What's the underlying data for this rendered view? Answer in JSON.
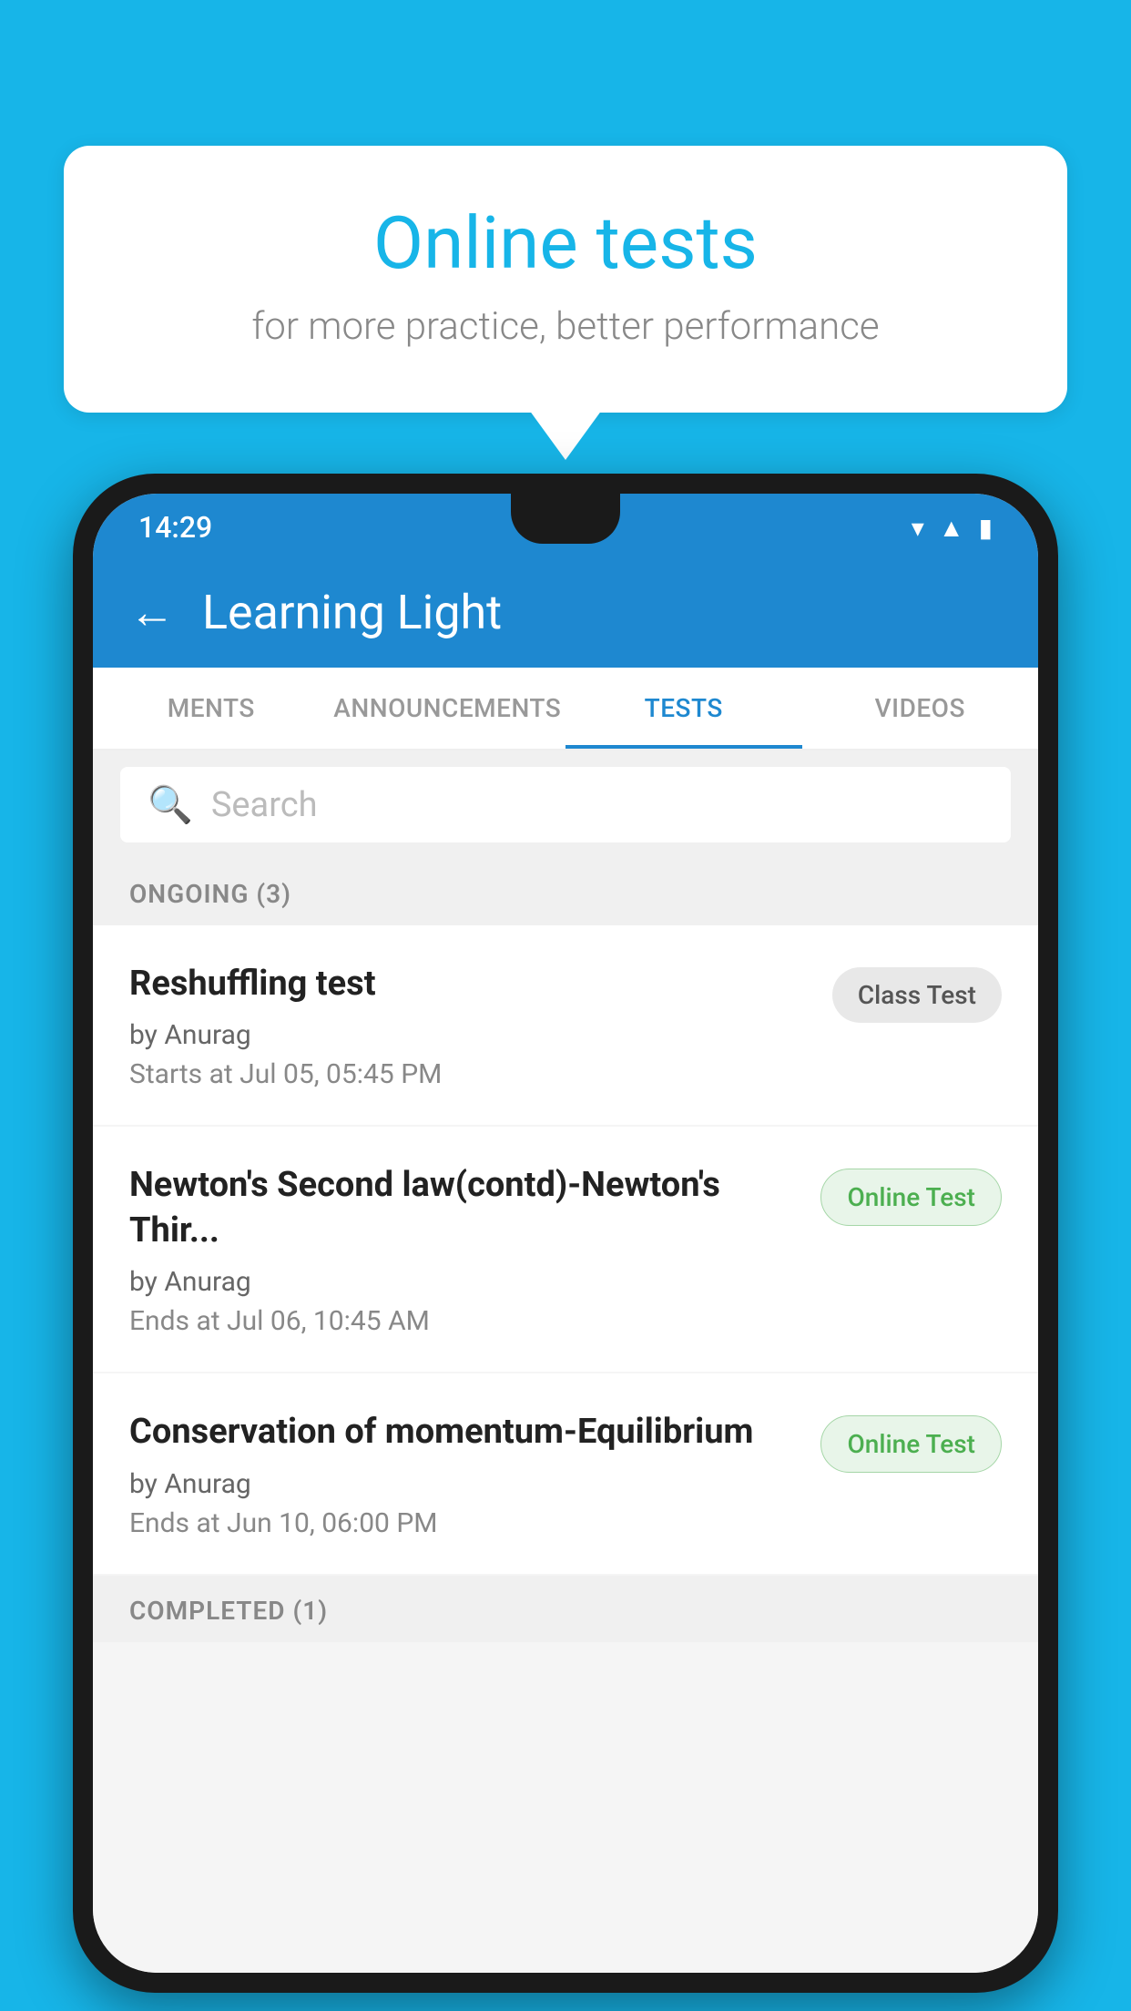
{
  "background_color": "#17b5e8",
  "bubble": {
    "title": "Online tests",
    "subtitle": "for more practice, better performance"
  },
  "phone": {
    "status_bar": {
      "time": "14:29",
      "icons": [
        "wifi",
        "signal",
        "battery"
      ]
    },
    "app_bar": {
      "title": "Learning Light",
      "back_label": "←"
    },
    "tabs": [
      {
        "label": "MENTS",
        "active": false
      },
      {
        "label": "ANNOUNCEMENTS",
        "active": false
      },
      {
        "label": "TESTS",
        "active": true
      },
      {
        "label": "VIDEOS",
        "active": false
      }
    ],
    "search": {
      "placeholder": "Search"
    },
    "sections": [
      {
        "id": "ongoing",
        "label": "ONGOING (3)",
        "items": [
          {
            "title": "Reshuffling test",
            "author": "by Anurag",
            "date": "Starts at  Jul 05, 05:45 PM",
            "badge": "Class Test",
            "badge_type": "class"
          },
          {
            "title": "Newton's Second law(contd)-Newton's Thir...",
            "author": "by Anurag",
            "date": "Ends at  Jul 06, 10:45 AM",
            "badge": "Online Test",
            "badge_type": "online"
          },
          {
            "title": "Conservation of momentum-Equilibrium",
            "author": "by Anurag",
            "date": "Ends at  Jun 10, 06:00 PM",
            "badge": "Online Test",
            "badge_type": "online"
          }
        ]
      },
      {
        "id": "completed",
        "label": "COMPLETED (1)",
        "items": []
      }
    ]
  }
}
